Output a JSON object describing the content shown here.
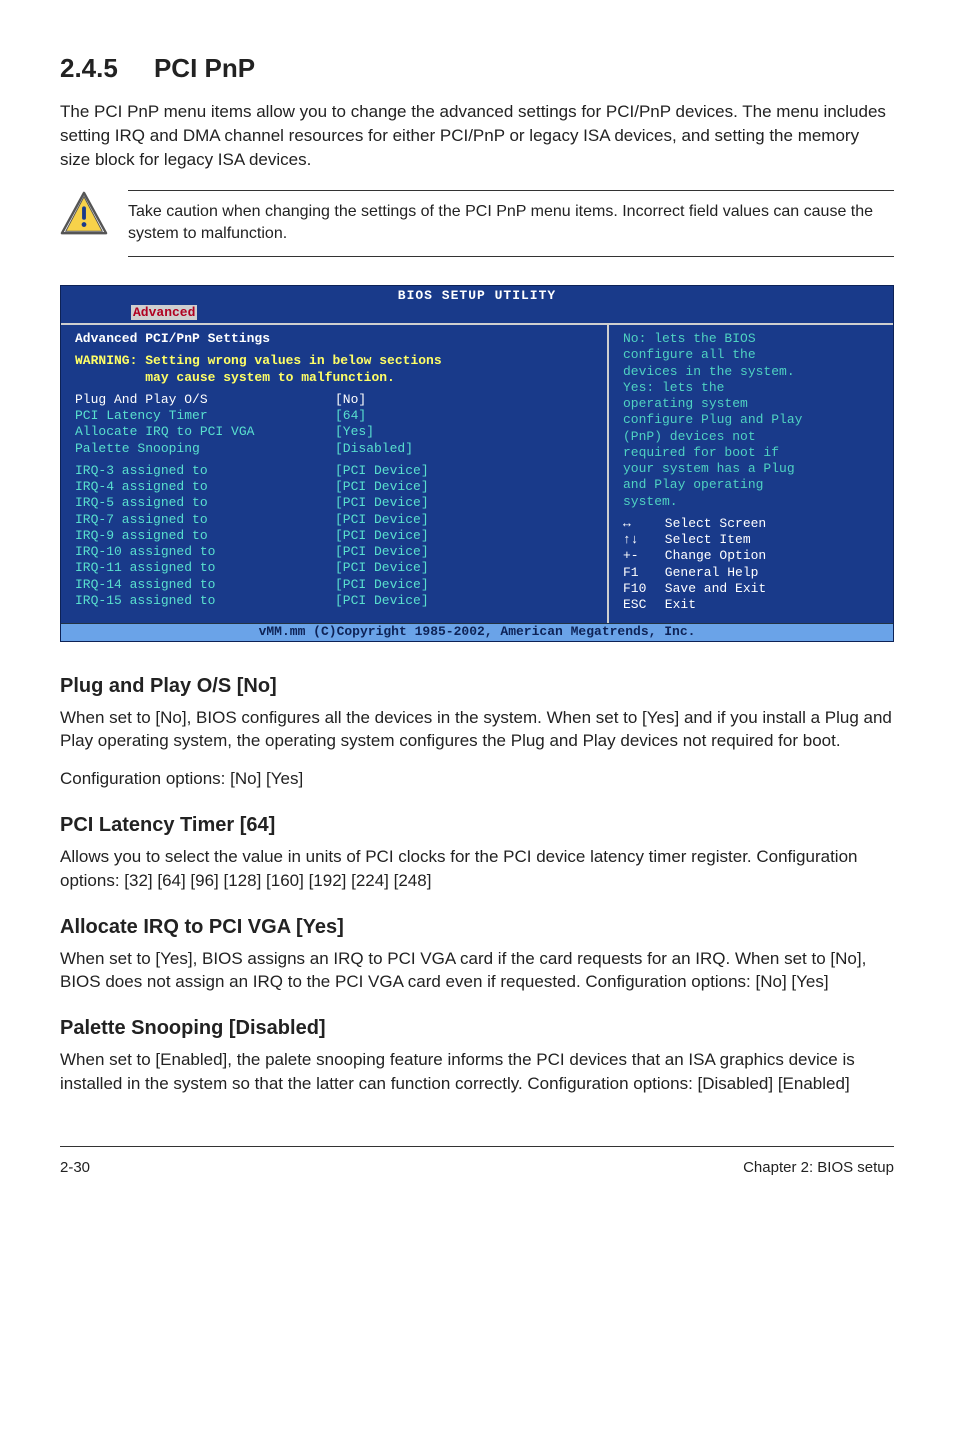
{
  "section": {
    "number": "2.4.5",
    "title": "PCI PnP",
    "intro": "The PCI PnP menu items allow you to change the advanced settings for PCI/PnP devices. The menu includes setting IRQ and DMA channel resources for either PCI/PnP or legacy ISA devices, and setting the memory size block for legacy ISA devices."
  },
  "callout": {
    "text": "Take caution when changing the settings of the PCI PnP menu items. Incorrect field values can cause the system to malfunction."
  },
  "bios": {
    "title": "BIOS SETUP UTILITY",
    "active_tab": "Advanced",
    "panel_heading": "Advanced PCI/PnP Settings",
    "warning_line1": "WARNING: Setting wrong values in below sections",
    "warning_line2": "         may cause system to malfunction.",
    "settings": [
      {
        "label": "Plug And Play O/S",
        "value": "[No]",
        "highlight": true
      },
      {
        "label": "PCI Latency Timer",
        "value": "[64]",
        "highlight": false
      },
      {
        "label": "Allocate IRQ to PCI VGA",
        "value": "[Yes]",
        "highlight": false
      },
      {
        "label": "Palette Snooping",
        "value": "[Disabled]",
        "highlight": false
      }
    ],
    "irq": [
      {
        "label": "IRQ-3 assigned to",
        "value": "[PCI Device]"
      },
      {
        "label": "IRQ-4 assigned to",
        "value": "[PCI Device]"
      },
      {
        "label": "IRQ-5 assigned to",
        "value": "[PCI Device]"
      },
      {
        "label": "IRQ-7 assigned to",
        "value": "[PCI Device]"
      },
      {
        "label": "IRQ-9 assigned to",
        "value": "[PCI Device]"
      },
      {
        "label": "IRQ-10 assigned to",
        "value": "[PCI Device]"
      },
      {
        "label": "IRQ-11 assigned to",
        "value": "[PCI Device]"
      },
      {
        "label": "IRQ-14 assigned to",
        "value": "[PCI Device]"
      },
      {
        "label": "IRQ-15 assigned to",
        "value": "[PCI Device]"
      }
    ],
    "help": {
      "lines": [
        "No: lets the BIOS",
        "configure all the",
        "devices in the system.",
        "Yes: lets the",
        "operating system",
        "configure Plug and Play",
        "(PnP) devices not",
        "required for boot if",
        "your system has a Plug",
        "and Play operating",
        "system."
      ],
      "keys": [
        {
          "sym": "↔",
          "desc": "Select Screen"
        },
        {
          "sym": "↑↓",
          "desc": "Select Item"
        },
        {
          "sym": "+-",
          "desc": "Change Option"
        },
        {
          "sym": "F1",
          "desc": "General Help"
        },
        {
          "sym": "F10",
          "desc": "Save and Exit"
        },
        {
          "sym": "ESC",
          "desc": "Exit"
        }
      ]
    },
    "footer": "vMM.mm (C)Copyright 1985-2002, American Megatrends, Inc."
  },
  "subsections": [
    {
      "heading": "Plug and Play O/S [No]",
      "body": "When set to [No], BIOS configures all the devices in the system. When set to [Yes] and if you install a Plug and Play operating system, the operating system configures the Plug and Play devices not required for boot.",
      "config": "Configuration options: [No] [Yes]"
    },
    {
      "heading": "PCI Latency Timer [64]",
      "body": "Allows you to select the value in units of PCI clocks for the PCI device latency timer register. Configuration options: [32] [64] [96] [128] [160] [192] [224] [248]",
      "config": ""
    },
    {
      "heading": "Allocate IRQ to PCI VGA [Yes]",
      "body": "When set to [Yes], BIOS assigns an IRQ to PCI VGA card if the card requests for an IRQ. When set to [No], BIOS does not assign an IRQ to the PCI VGA card even if requested. Configuration options: [No] [Yes]",
      "config": ""
    },
    {
      "heading": "Palette Snooping [Disabled]",
      "body": "When set to [Enabled], the palete snooping feature informs the PCI devices that an ISA graphics device is installed in the system so that the latter can function correctly. Configuration options: [Disabled] [Enabled]",
      "config": ""
    }
  ],
  "footer": {
    "left": "2-30",
    "right": "Chapter 2: BIOS setup"
  }
}
